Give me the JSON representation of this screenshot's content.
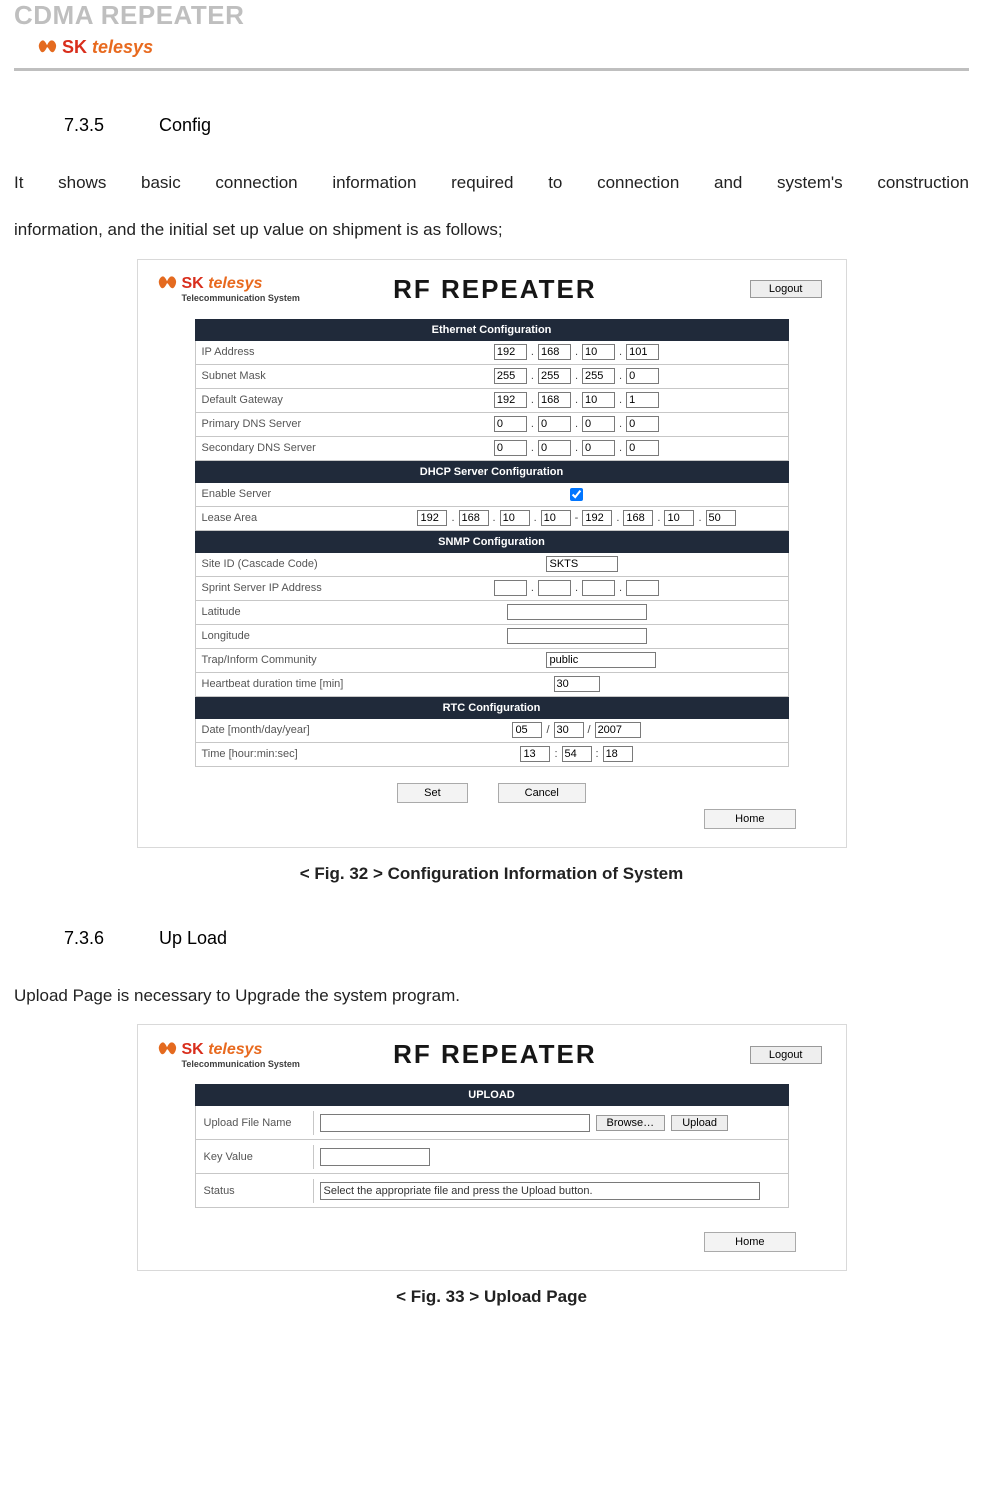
{
  "doc": {
    "title": "CDMA REPEATER",
    "brand_sk": "SK",
    "brand_telesys": "telesys",
    "brand_sub": "Telecommunication System"
  },
  "s1": {
    "num": "7.3.5",
    "name": "Config",
    "para1": "It shows basic connection information required to connection and system's construction",
    "para2": "information, and the initial set up value on shipment is as follows;",
    "caption": "< Fig. 32 > Configuration Information of System"
  },
  "s2": {
    "num": "7.3.6",
    "name": "Up Load",
    "para": "Upload Page is necessary to Upgrade the system program.",
    "caption": "< Fig. 33 > Upload Page"
  },
  "shot": {
    "title": "RF  REPEATER",
    "logout": "Logout",
    "set": "Set",
    "cancel": "Cancel",
    "home": "Home",
    "eth_head": "Ethernet Configuration",
    "ip_lbl": "IP Address",
    "ip": [
      "192",
      "168",
      "10",
      "101"
    ],
    "sm_lbl": "Subnet Mask",
    "sm": [
      "255",
      "255",
      "255",
      "0"
    ],
    "gw_lbl": "Default Gateway",
    "gw": [
      "192",
      "168",
      "10",
      "1"
    ],
    "d1_lbl": "Primary DNS Server",
    "d1": [
      "0",
      "0",
      "0",
      "0"
    ],
    "d2_lbl": "Secondary DNS Server",
    "d2": [
      "0",
      "0",
      "0",
      "0"
    ],
    "dhcp_head": "DHCP Server Configuration",
    "en_lbl": "Enable Server",
    "la_lbl": "Lease Area",
    "la_from": [
      "192",
      "168",
      "10",
      "10"
    ],
    "la_to": [
      "192",
      "168",
      "10",
      "50"
    ],
    "snmp_head": "SNMP Configuration",
    "site_lbl": "Site ID (Cascade Code)",
    "site": "SKTS",
    "sprint_lbl": "Sprint Server IP Address",
    "lat_lbl": "Latitude",
    "lat": "",
    "lon_lbl": "Longitude",
    "lon": "",
    "trap_lbl": "Trap/Inform Community",
    "trap": "public",
    "hb_lbl": "Heartbeat duration time [min]",
    "hb": "30",
    "rtc_head": "RTC Configuration",
    "date_lbl": "Date [month/day/year]",
    "date": [
      "05",
      "30",
      "2007"
    ],
    "time_lbl": "Time [hour:min:sec]",
    "time": [
      "13",
      "54",
      "18"
    ]
  },
  "up": {
    "head": "UPLOAD",
    "file_lbl": "Upload File Name",
    "browse": "Browse…",
    "upload": "Upload",
    "key_lbl": "Key Value",
    "status_lbl": "Status",
    "status_val": "Select the appropriate file and press the Upload button."
  }
}
